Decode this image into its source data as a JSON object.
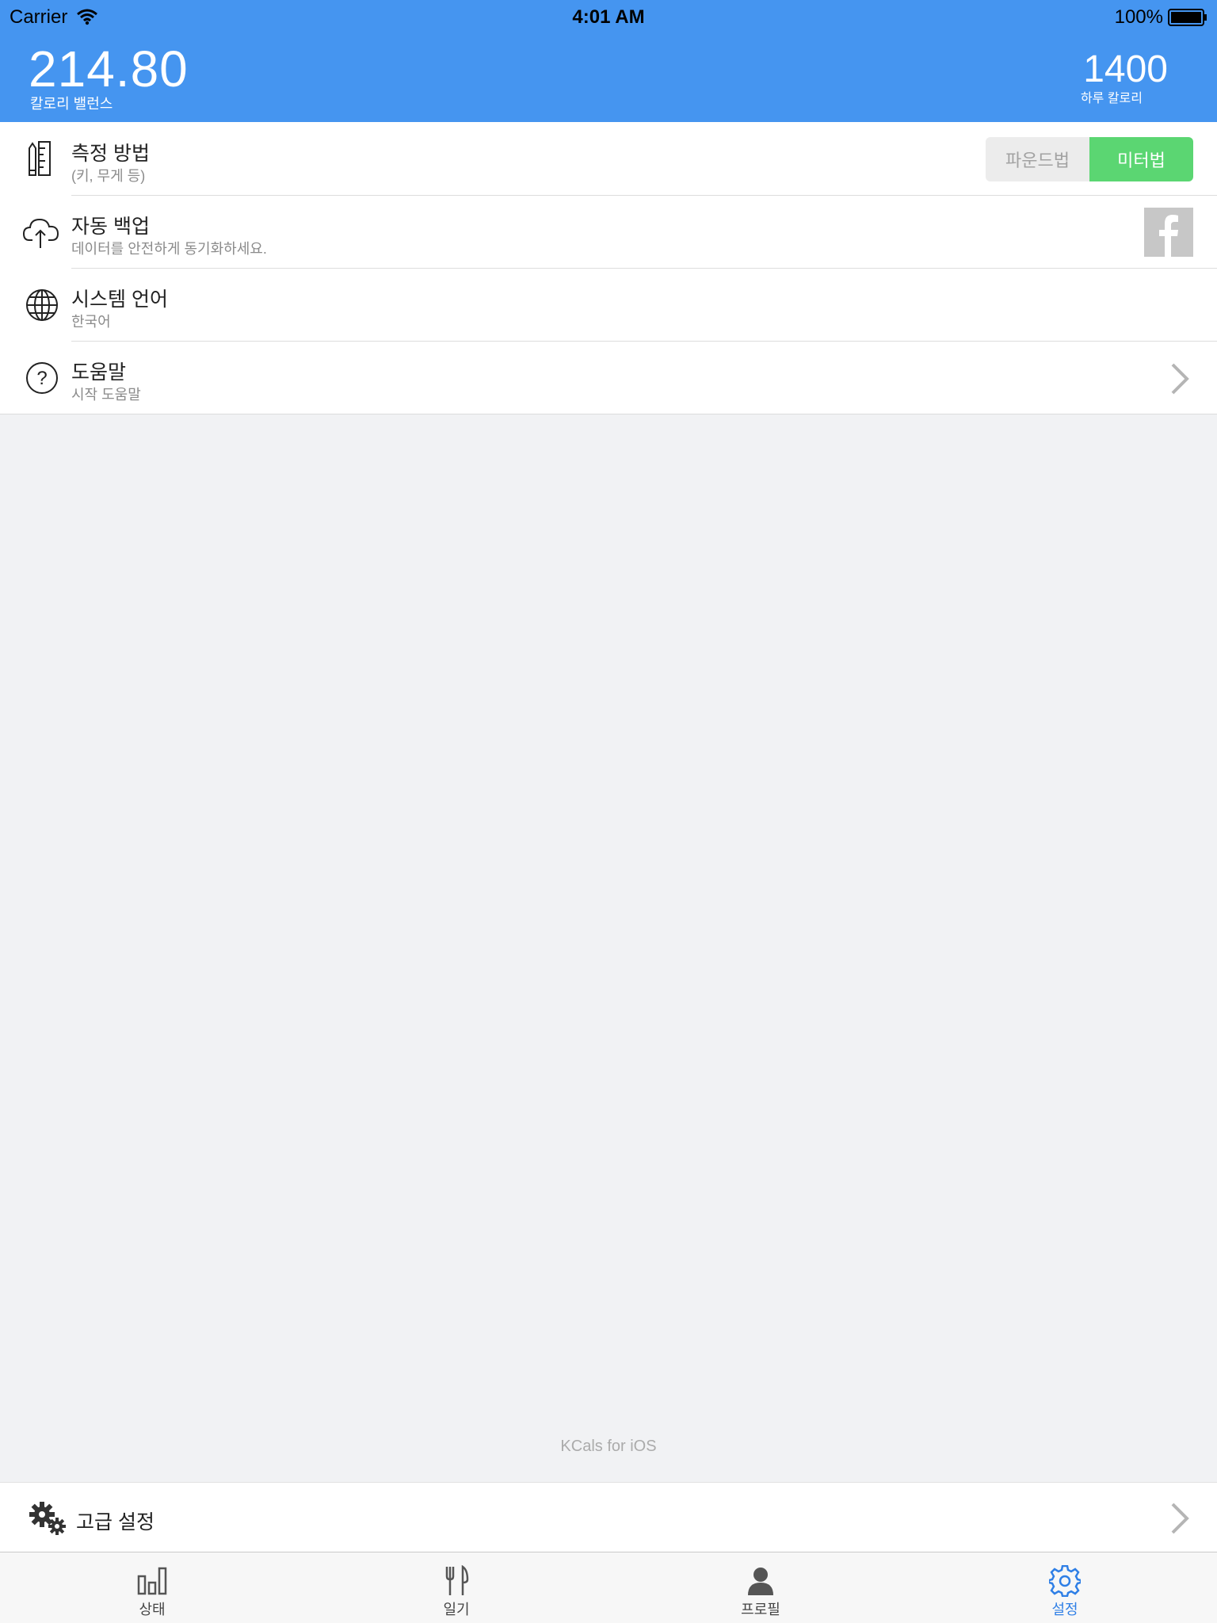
{
  "status_bar": {
    "carrier": "Carrier",
    "time": "4:01 AM",
    "battery": "100%"
  },
  "header": {
    "balance_value": "214.80",
    "balance_label": "칼로리 밸런스",
    "daily_value": "1400",
    "daily_label": "하루 칼로리"
  },
  "settings": {
    "measure": {
      "title": "측정 방법",
      "subtitle": "(키, 무게 등)",
      "options": [
        "파운드법",
        "미터법"
      ],
      "selected": "미터법"
    },
    "backup": {
      "title": "자동 백업",
      "subtitle": "데이터를 안전하게 동기화하세요."
    },
    "language": {
      "title": "시스템 언어",
      "subtitle": "한국어"
    },
    "help": {
      "title": "도움말",
      "subtitle": "시작 도움말"
    }
  },
  "footer_text": "KCals for iOS",
  "advanced": {
    "label": "고급 설정"
  },
  "tabbar": {
    "tabs": [
      {
        "label": "상태",
        "icon": "bar-chart-icon"
      },
      {
        "label": "일기",
        "icon": "fork-knife-icon"
      },
      {
        "label": "프로필",
        "icon": "person-icon"
      },
      {
        "label": "설정",
        "icon": "gear-icon"
      }
    ],
    "active": "설정"
  },
  "colors": {
    "header": "#4595f0",
    "segment_active": "#5bd672",
    "tab_active": "#2f7fe6",
    "background": "#f1f2f4"
  }
}
